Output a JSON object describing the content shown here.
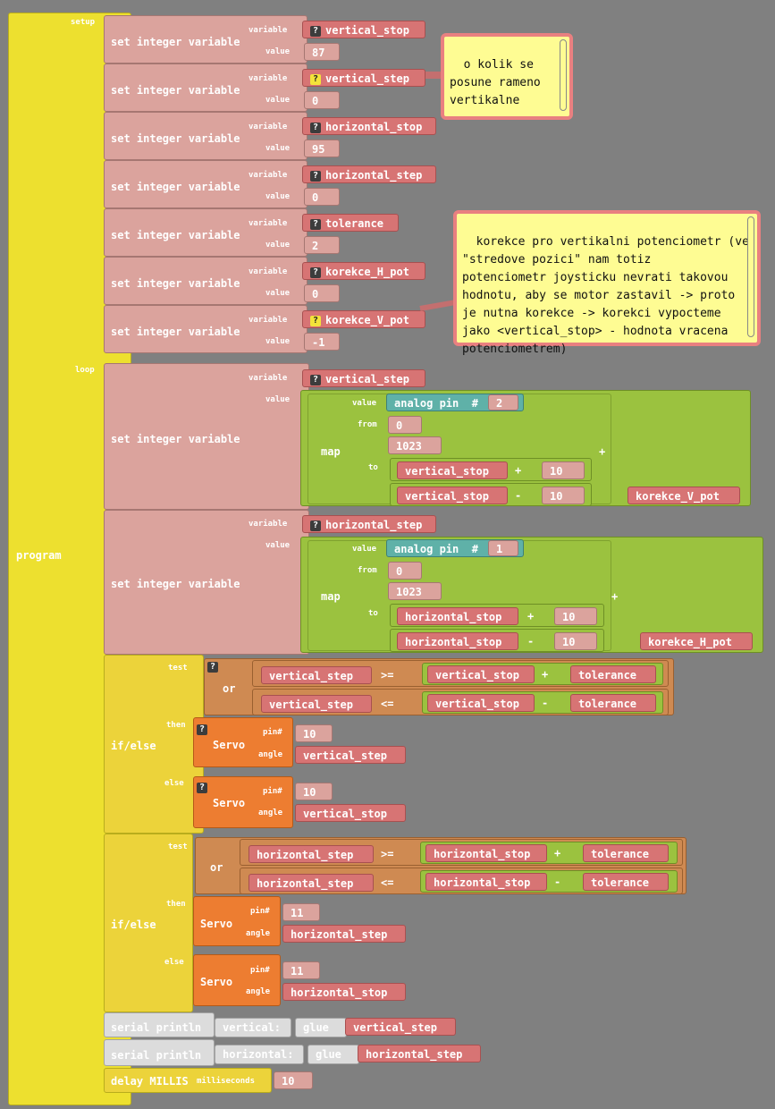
{
  "labels": {
    "program": "program",
    "setup": "setup",
    "loop": "loop",
    "set_integer_variable": "set integer variable",
    "variable": "variable",
    "value": "value",
    "map": "map",
    "from": "from",
    "to": "to",
    "analog_pin": "analog pin",
    "hash": "#",
    "if_else": "if/else",
    "test": "test",
    "then": "then",
    "else": "else",
    "or": "or",
    "servo": "Servo",
    "pin_hash": "pin#",
    "angle": "angle",
    "serial_println": "serial println",
    "glue": "glue",
    "delay_millis": "delay MILLIS",
    "milliseconds": "milliseconds",
    "plus": "+",
    "minus": "-",
    "ge": ">=",
    "le": "<=",
    "qmark": "?"
  },
  "setup": [
    {
      "variable": "vertical_stop",
      "value": "87",
      "icon": "gray"
    },
    {
      "variable": "vertical_step",
      "value": "0",
      "icon": "yellow"
    },
    {
      "variable": "horizontal_stop",
      "value": "95",
      "icon": "gray"
    },
    {
      "variable": "horizontal_step",
      "value": "0",
      "icon": "gray"
    },
    {
      "variable": "tolerance",
      "value": "2",
      "icon": "gray"
    },
    {
      "variable": "korekce_H_pot",
      "value": "0",
      "icon": "gray"
    },
    {
      "variable": "korekce_V_pot",
      "value": "-1",
      "icon": "yellow"
    }
  ],
  "loop_vertical": {
    "variable": "vertical_step",
    "pin": "2",
    "from": "0",
    "from_high": "1023",
    "to_low_var": "vertical_stop",
    "to_low_op": "+",
    "to_low_num": "10",
    "to_high_var": "vertical_stop",
    "to_high_op": "-",
    "to_high_num": "10",
    "plus": "+",
    "correction": "korekce_V_pot"
  },
  "loop_horizontal": {
    "variable": "horizontal_step",
    "pin": "1",
    "from": "0",
    "from_high": "1023",
    "to_low_var": "horizontal_stop",
    "to_low_op": "+",
    "to_low_num": "10",
    "to_high_var": "horizontal_stop",
    "to_high_op": "-",
    "to_high_num": "10",
    "plus": "+",
    "correction": "korekce_H_pot"
  },
  "if_vertical": {
    "a_left": "vertical_step",
    "a_op": ">=",
    "a_right": "vertical_stop",
    "a_op2": "+",
    "a_tol": "tolerance",
    "b_left": "vertical_step",
    "b_op": "<=",
    "b_right": "vertical_stop",
    "b_op2": "-",
    "b_tol": "tolerance",
    "then_pin": "10",
    "then_angle": "vertical_step",
    "else_pin": "10",
    "else_angle": "vertical_stop"
  },
  "if_horizontal": {
    "a_left": "horizontal_step",
    "a_op": ">=",
    "a_right": "horizontal_stop",
    "a_op2": "+",
    "a_tol": "tolerance",
    "b_left": "horizontal_step",
    "b_op": "<=",
    "b_right": "horizontal_stop",
    "b_op2": "-",
    "b_tol": "tolerance",
    "then_pin": "11",
    "then_angle": "horizontal_step",
    "else_pin": "11",
    "else_angle": "horizontal_stop"
  },
  "serial": [
    {
      "text": "vertical:",
      "variable": "vertical_step"
    },
    {
      "text": "horizontal:",
      "variable": "horizontal_step"
    }
  ],
  "delay": {
    "ms": "10"
  },
  "comments": {
    "one": "o kolik se\nposune rameno\nvertikalne",
    "two": "korekce pro vertikalni potenciometr (ve\n\"stredove pozici\" nam totiz\npotenciometr joysticku nevrati takovou\nhodnotu, aby se motor zastavil -> proto\nje nutna korekce -> korekci vypocteme\njako <vertical_stop> - hodnota vracena\npotenciometrem)"
  }
}
